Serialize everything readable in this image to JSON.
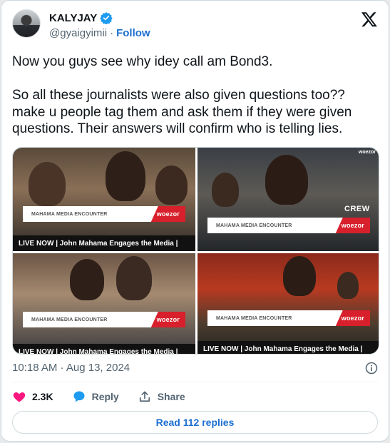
{
  "author": {
    "display_name": "KALYJAY",
    "handle": "@gyaigyimii",
    "separator": "·",
    "follow_label": "Follow",
    "verified": true
  },
  "tweet": {
    "text": "Now you guys see why idey call am Bond3.\n\nSo all these journalists were also given questions too??\nmake u people tag them and ask them if they were given\nquestions. Their answers will confirm who is telling lies.",
    "timestamp": "10:18 AM · Aug 13, 2024"
  },
  "media": {
    "tiles": [
      {
        "banner": "MAHAMA MEDIA ENCOUNTER",
        "brand": "woezor",
        "live": "LIVE NOW | John Mahama Engages the Media |"
      },
      {
        "banner": "MAHAMA MEDIA ENCOUNTER",
        "brand": "woezor",
        "overlay": "CREW",
        "corner": "woezor"
      },
      {
        "banner": "MAHAMA MEDIA ENCOUNTER",
        "brand": "woezor",
        "live": "LIVE NOW | John Mahama Engages the Media |"
      },
      {
        "banner": "MAHAMA MEDIA ENCOUNTER",
        "brand": "woezor",
        "live": "LIVE NOW | John Mahama Engages the Media |"
      }
    ]
  },
  "actions": {
    "likes": "2.3K",
    "reply_label": "Reply",
    "share_label": "Share"
  },
  "read_replies_label": "Read 112 replies",
  "colors": {
    "accent": "#1d9bf0",
    "link": "#1d6fd1",
    "like": "#f91880",
    "brand_red": "#d7202b"
  }
}
